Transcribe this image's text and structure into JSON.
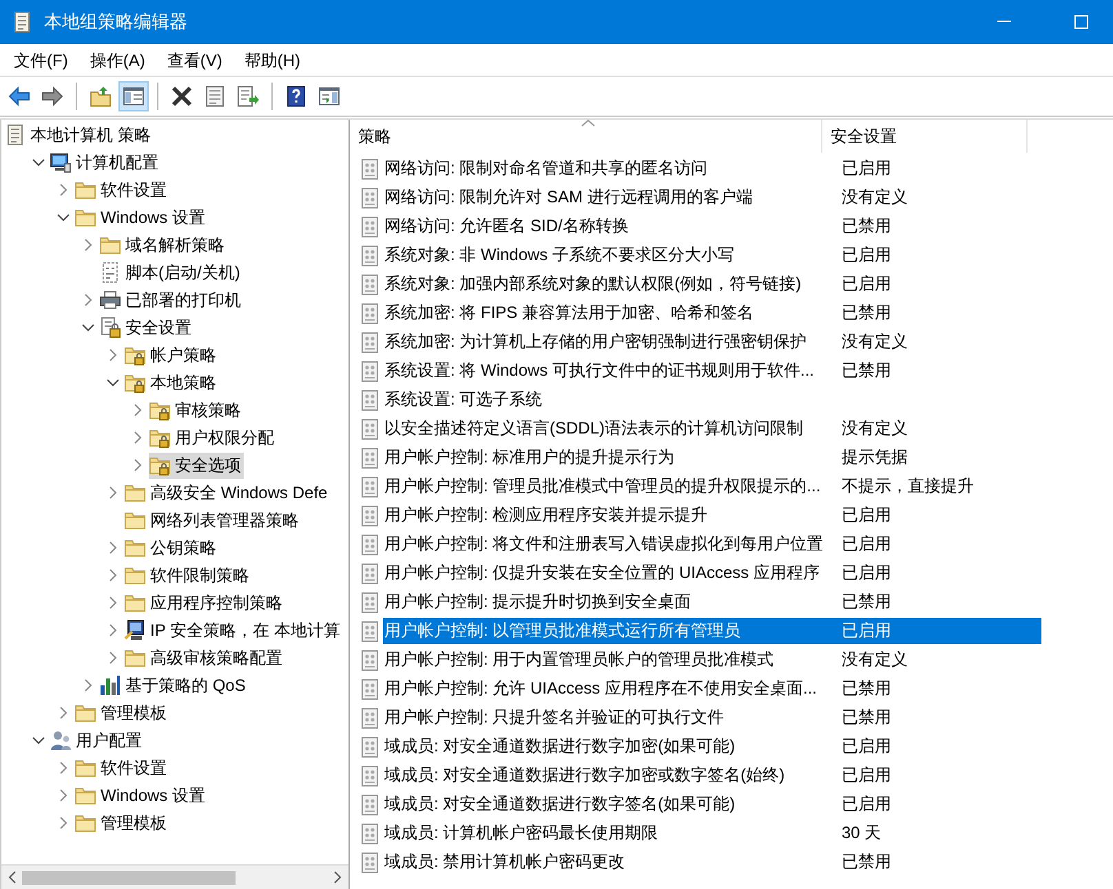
{
  "window": {
    "title": "本地组策略编辑器"
  },
  "menu": [
    {
      "label": "文件(F)"
    },
    {
      "label": "操作(A)"
    },
    {
      "label": "查看(V)"
    },
    {
      "label": "帮助(H)"
    }
  ],
  "toolbar": [
    {
      "kind": "back",
      "pressed": false
    },
    {
      "kind": "forward",
      "pressed": false
    },
    {
      "kind": "separator"
    },
    {
      "kind": "up",
      "pressed": false
    },
    {
      "kind": "tree",
      "pressed": true
    },
    {
      "kind": "separator"
    },
    {
      "kind": "delete",
      "pressed": false
    },
    {
      "kind": "properties",
      "pressed": false
    },
    {
      "kind": "export",
      "pressed": false
    },
    {
      "kind": "separator"
    },
    {
      "kind": "help",
      "pressed": false
    },
    {
      "kind": "pane",
      "pressed": false
    }
  ],
  "tree": [
    {
      "label": "本地计算机 策略",
      "kind": "doc",
      "selected": false,
      "children": [
        {
          "label": "计算机配置",
          "kind": "computer",
          "expanded": true,
          "selected": false,
          "children": [
            {
              "label": "软件设置",
              "kind": "folder",
              "expanded": false,
              "selected": false
            },
            {
              "label": "Windows 设置",
              "kind": "folder",
              "expanded": true,
              "selected": false,
              "children": [
                {
                  "label": "域名解析策略",
                  "kind": "folder",
                  "expanded": false,
                  "selected": false
                },
                {
                  "label": "脚本(启动/关机)",
                  "kind": "script",
                  "selected": false
                },
                {
                  "label": "已部署的打印机",
                  "kind": "printer",
                  "expanded": false,
                  "selected": false
                },
                {
                  "label": "安全设置",
                  "kind": "security",
                  "expanded": true,
                  "selected": false,
                  "children": [
                    {
                      "label": "帐户策略",
                      "kind": "lockfolder",
                      "expanded": false,
                      "selected": false
                    },
                    {
                      "label": "本地策略",
                      "kind": "lockfolder",
                      "expanded": true,
                      "selected": false,
                      "children": [
                        {
                          "label": "审核策略",
                          "kind": "lockfolder",
                          "expanded": false,
                          "selected": false
                        },
                        {
                          "label": "用户权限分配",
                          "kind": "lockfolder",
                          "expanded": false,
                          "selected": false
                        },
                        {
                          "label": "安全选项",
                          "kind": "lockfolder",
                          "expanded": false,
                          "selected": true
                        }
                      ]
                    },
                    {
                      "label": "高级安全 Windows Defe",
                      "kind": "folder",
                      "expanded": false,
                      "selected": false
                    },
                    {
                      "label": "网络列表管理器策略",
                      "kind": "folder",
                      "selected": false
                    },
                    {
                      "label": "公钥策略",
                      "kind": "folder",
                      "expanded": false,
                      "selected": false
                    },
                    {
                      "label": "软件限制策略",
                      "kind": "folder",
                      "expanded": false,
                      "selected": false
                    },
                    {
                      "label": "应用程序控制策略",
                      "kind": "folder",
                      "expanded": false,
                      "selected": false
                    },
                    {
                      "label": "IP 安全策略，在 本地计算",
                      "kind": "ipsec",
                      "expanded": false,
                      "selected": false
                    },
                    {
                      "label": "高级审核策略配置",
                      "kind": "folder",
                      "expanded": false,
                      "selected": false
                    }
                  ]
                },
                {
                  "label": "基于策略的 QoS",
                  "kind": "qos",
                  "expanded": false,
                  "selected": false
                }
              ]
            },
            {
              "label": "管理模板",
              "kind": "folder",
              "expanded": false,
              "selected": false
            }
          ]
        },
        {
          "label": "用户配置",
          "kind": "user",
          "expanded": true,
          "selected": false,
          "children": [
            {
              "label": "软件设置",
              "kind": "folder",
              "expanded": false,
              "selected": false
            },
            {
              "label": "Windows 设置",
              "kind": "folder",
              "expanded": false,
              "selected": false
            },
            {
              "label": "管理模板",
              "kind": "folder",
              "expanded": false,
              "selected": false
            }
          ]
        }
      ]
    }
  ],
  "table": {
    "columns": [
      "策略",
      "安全设置"
    ],
    "rows": [
      {
        "policy": "网络访问: 限制对命名管道和共享的匿名访问",
        "setting": "已启用",
        "selected": false
      },
      {
        "policy": "网络访问: 限制允许对 SAM 进行远程调用的客户端",
        "setting": "没有定义",
        "selected": false
      },
      {
        "policy": "网络访问: 允许匿名 SID/名称转换",
        "setting": "已禁用",
        "selected": false
      },
      {
        "policy": "系统对象: 非 Windows 子系统不要求区分大小写",
        "setting": "已启用",
        "selected": false
      },
      {
        "policy": "系统对象: 加强内部系统对象的默认权限(例如，符号链接)",
        "setting": "已启用",
        "selected": false
      },
      {
        "policy": "系统加密: 将 FIPS 兼容算法用于加密、哈希和签名",
        "setting": "已禁用",
        "selected": false
      },
      {
        "policy": "系统加密: 为计算机上存储的用户密钥强制进行强密钥保护",
        "setting": "没有定义",
        "selected": false
      },
      {
        "policy": "系统设置: 将 Windows 可执行文件中的证书规则用于软件...",
        "setting": "已禁用",
        "selected": false
      },
      {
        "policy": "系统设置: 可选子系统",
        "selected": false
      },
      {
        "policy": "以安全描述符定义语言(SDDL)语法表示的计算机访问限制",
        "setting": "没有定义",
        "selected": false
      },
      {
        "policy": "用户帐户控制: 标准用户的提升提示行为",
        "setting": "提示凭据",
        "selected": false
      },
      {
        "policy": "用户帐户控制: 管理员批准模式中管理员的提升权限提示的...",
        "setting": "不提示，直接提升",
        "selected": false
      },
      {
        "policy": "用户帐户控制: 检测应用程序安装并提示提升",
        "setting": "已启用",
        "selected": false
      },
      {
        "policy": "用户帐户控制: 将文件和注册表写入错误虚拟化到每用户位置",
        "setting": "已启用",
        "selected": false
      },
      {
        "policy": "用户帐户控制: 仅提升安装在安全位置的 UIAccess 应用程序",
        "setting": "已启用",
        "selected": false
      },
      {
        "policy": "用户帐户控制: 提示提升时切换到安全桌面",
        "setting": "已禁用",
        "selected": false
      },
      {
        "policy": "用户帐户控制: 以管理员批准模式运行所有管理员",
        "setting": "已启用",
        "selected": true
      },
      {
        "policy": "用户帐户控制: 用于内置管理员帐户的管理员批准模式",
        "setting": "没有定义",
        "selected": false
      },
      {
        "policy": "用户帐户控制: 允许 UIAccess 应用程序在不使用安全桌面...",
        "setting": "已禁用",
        "selected": false
      },
      {
        "policy": "用户帐户控制: 只提升签名并验证的可执行文件",
        "setting": "已禁用",
        "selected": false
      },
      {
        "policy": "域成员: 对安全通道数据进行数字加密(如果可能)",
        "setting": "已启用",
        "selected": false
      },
      {
        "policy": "域成员: 对安全通道数据进行数字加密或数字签名(始终)",
        "setting": "已启用",
        "selected": false
      },
      {
        "policy": "域成员: 对安全通道数据进行数字签名(如果可能)",
        "setting": "已启用",
        "selected": false
      },
      {
        "policy": "域成员: 计算机帐户密码最长使用期限",
        "setting": "30 天",
        "selected": false
      },
      {
        "policy": "域成员: 禁用计算机帐户密码更改",
        "setting": "已禁用",
        "selected": false
      }
    ]
  }
}
